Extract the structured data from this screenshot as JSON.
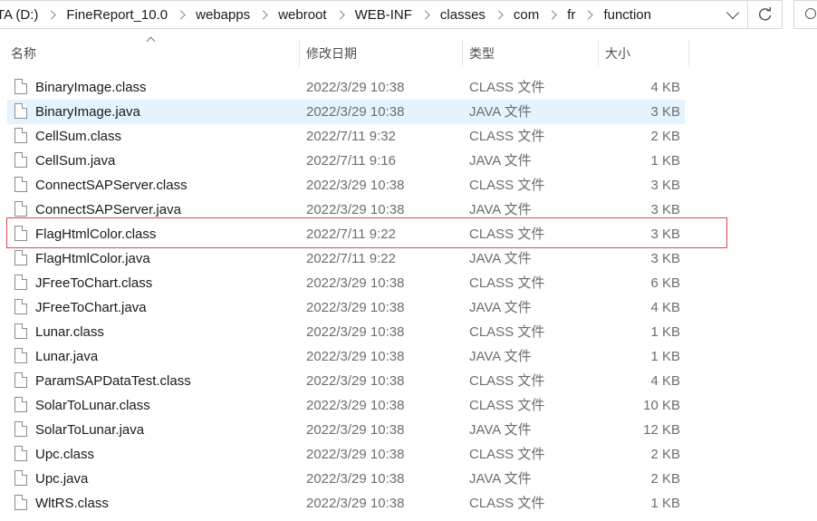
{
  "breadcrumb": [
    {
      "label": "TA (D:)"
    },
    {
      "label": "FineReport_10.0"
    },
    {
      "label": "webapps"
    },
    {
      "label": "webroot"
    },
    {
      "label": "WEB-INF"
    },
    {
      "label": "classes"
    },
    {
      "label": "com"
    },
    {
      "label": "fr"
    },
    {
      "label": "function"
    }
  ],
  "columns": {
    "name": "名称",
    "date": "修改日期",
    "type": "类型",
    "size": "大小"
  },
  "files": [
    {
      "name": "BinaryImage.class",
      "date": "2022/3/29 10:38",
      "type": "CLASS 文件",
      "size": "4 KB"
    },
    {
      "name": "BinaryImage.java",
      "date": "2022/3/29 10:38",
      "type": "JAVA 文件",
      "size": "3 KB"
    },
    {
      "name": "CellSum.class",
      "date": "2022/7/11 9:32",
      "type": "CLASS 文件",
      "size": "2 KB"
    },
    {
      "name": "CellSum.java",
      "date": "2022/7/11 9:16",
      "type": "JAVA 文件",
      "size": "1 KB"
    },
    {
      "name": "ConnectSAPServer.class",
      "date": "2022/3/29 10:38",
      "type": "CLASS 文件",
      "size": "3 KB"
    },
    {
      "name": "ConnectSAPServer.java",
      "date": "2022/3/29 10:38",
      "type": "JAVA 文件",
      "size": "3 KB"
    },
    {
      "name": "FlagHtmlColor.class",
      "date": "2022/7/11 9:22",
      "type": "CLASS 文件",
      "size": "3 KB"
    },
    {
      "name": "FlagHtmlColor.java",
      "date": "2022/7/11 9:22",
      "type": "JAVA 文件",
      "size": "3 KB"
    },
    {
      "name": "JFreeToChart.class",
      "date": "2022/3/29 10:38",
      "type": "CLASS 文件",
      "size": "6 KB"
    },
    {
      "name": "JFreeToChart.java",
      "date": "2022/3/29 10:38",
      "type": "JAVA 文件",
      "size": "4 KB"
    },
    {
      "name": "Lunar.class",
      "date": "2022/3/29 10:38",
      "type": "CLASS 文件",
      "size": "1 KB"
    },
    {
      "name": "Lunar.java",
      "date": "2022/3/29 10:38",
      "type": "JAVA 文件",
      "size": "1 KB"
    },
    {
      "name": "ParamSAPDataTest.class",
      "date": "2022/3/29 10:38",
      "type": "CLASS 文件",
      "size": "4 KB"
    },
    {
      "name": "SolarToLunar.class",
      "date": "2022/3/29 10:38",
      "type": "CLASS 文件",
      "size": "10 KB"
    },
    {
      "name": "SolarToLunar.java",
      "date": "2022/3/29 10:38",
      "type": "JAVA 文件",
      "size": "12 KB"
    },
    {
      "name": "Upc.class",
      "date": "2022/3/29 10:38",
      "type": "CLASS 文件",
      "size": "2 KB"
    },
    {
      "name": "Upc.java",
      "date": "2022/3/29 10:38",
      "type": "JAVA 文件",
      "size": "2 KB"
    },
    {
      "name": "WltRS.class",
      "date": "2022/3/29 10:38",
      "type": "CLASS 文件",
      "size": "1 KB"
    }
  ],
  "hovered_file": "BinaryImage.java",
  "highlighted_file": "FlagHtmlColor.class",
  "colors": {
    "hover_bg": "#e5f3ff",
    "highlight_border": "#e0454a"
  },
  "icons": [
    "chevron-down-icon",
    "refresh-icon",
    "search-icon",
    "sort-up-icon",
    "file-icon"
  ]
}
